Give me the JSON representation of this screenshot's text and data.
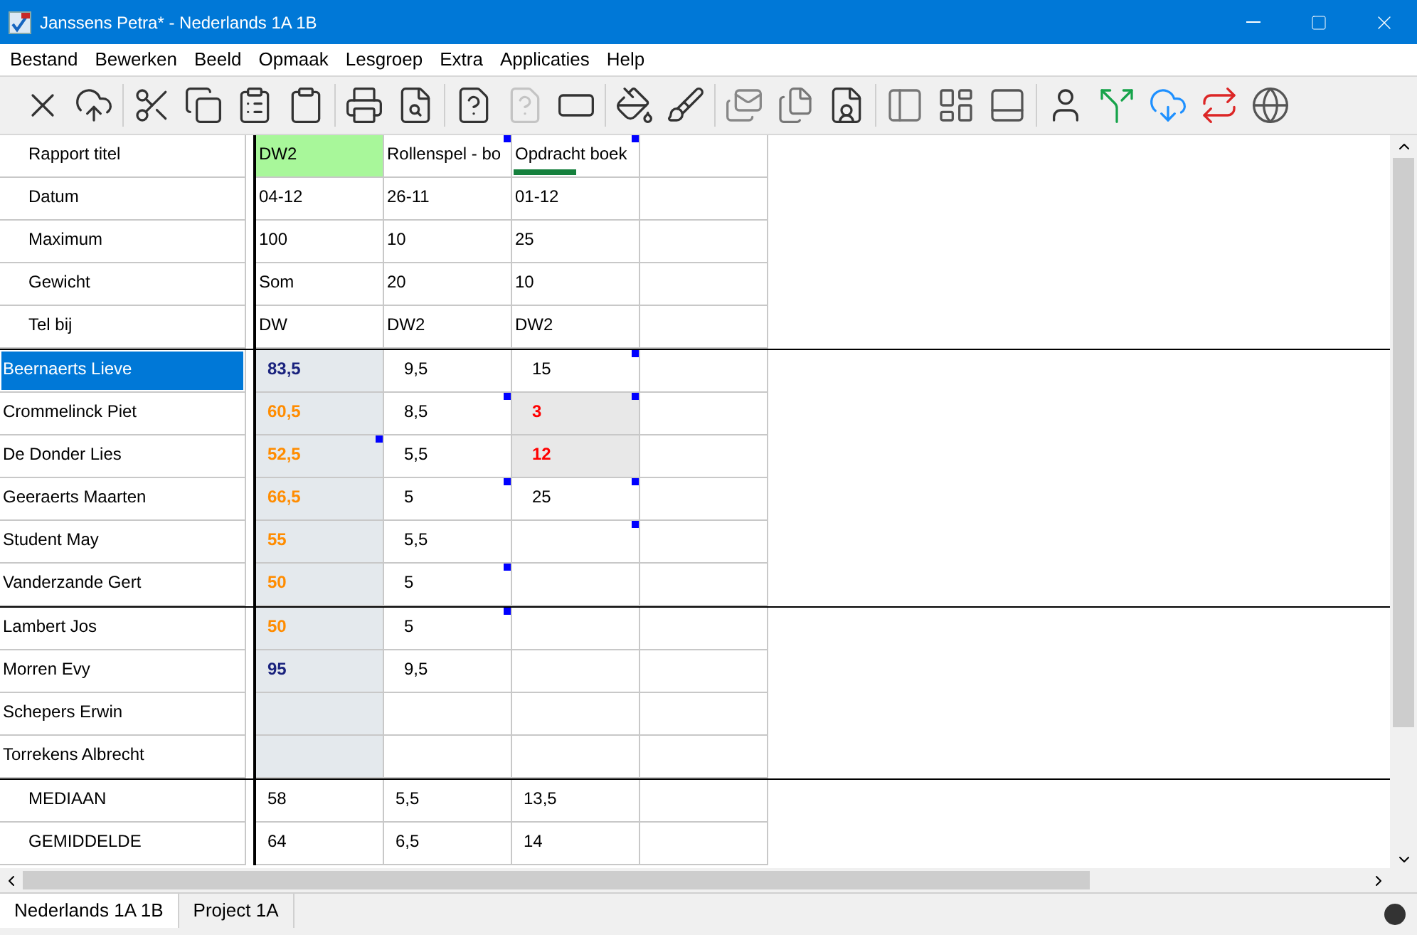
{
  "window": {
    "title": "Janssens Petra* - Nederlands 1A 1B"
  },
  "menu": [
    "Bestand",
    "Bewerken",
    "Beeld",
    "Opmaak",
    "Lesgroep",
    "Extra",
    "Applicaties",
    "Help"
  ],
  "toolbar": [
    {
      "disabled": false
    },
    {
      "disabled": false
    },
    {
      "disabled": false
    },
    {
      "disabled": false
    },
    {
      "disabled": false
    },
    {
      "disabled": false
    },
    {
      "disabled": false
    },
    {
      "disabled": false
    },
    {
      "disabled": false
    },
    {
      "disabled": true
    },
    {
      "disabled": false
    },
    {
      "disabled": false
    },
    {
      "disabled": false
    },
    {
      "disabled": false
    },
    {
      "disabled": false
    },
    {
      "disabled": false
    },
    {
      "disabled": false
    },
    {
      "disabled": false
    },
    {
      "disabled": false
    },
    {
      "disabled": false
    },
    {
      "disabled": false
    },
    {
      "disabled": false
    },
    {
      "disabled": false
    },
    {
      "disabled": false
    }
  ],
  "header_rows": [
    {
      "label": "Rapport titel",
      "cells": [
        {
          "text": "DW2",
          "highlight": true,
          "marker": false,
          "bar": false
        },
        {
          "text": "Rollenspel - bo",
          "highlight": false,
          "marker": true,
          "bar": false
        },
        {
          "text": "Opdracht boek",
          "highlight": false,
          "marker": true,
          "bar": true
        }
      ]
    },
    {
      "label": "Datum",
      "cells": [
        {
          "text": "04-12"
        },
        {
          "text": "26-11"
        },
        {
          "text": "01-12"
        }
      ]
    },
    {
      "label": "Maximum",
      "cells": [
        {
          "text": "100"
        },
        {
          "text": "10"
        },
        {
          "text": "25"
        }
      ]
    },
    {
      "label": "Gewicht",
      "cells": [
        {
          "text": "Som"
        },
        {
          "text": "20"
        },
        {
          "text": "10"
        }
      ]
    },
    {
      "label": "Tel bij",
      "cells": [
        {
          "text": "DW"
        },
        {
          "text": "DW2"
        },
        {
          "text": "DW2"
        }
      ]
    }
  ],
  "student_groups": [
    [
      {
        "name": "Beernaerts Lieve",
        "selected": true,
        "cells": [
          {
            "text": "83,5",
            "color": "#1a237e",
            "shaded": true,
            "marker": false
          },
          {
            "text": "9,5",
            "shaded": false,
            "marker": false
          },
          {
            "text": "15",
            "shaded": false,
            "marker": true
          }
        ]
      },
      {
        "name": "Crommelinck Piet",
        "selected": false,
        "cells": [
          {
            "text": "60,5",
            "color": "#ff8c00",
            "shaded": true,
            "marker": false
          },
          {
            "text": "8,5",
            "shaded": false,
            "marker": true
          },
          {
            "text": "3",
            "color": "#ff0000",
            "shaded": true,
            "marker": true
          }
        ]
      },
      {
        "name": "De Donder Lies",
        "selected": false,
        "cells": [
          {
            "text": "52,5",
            "color": "#ff8c00",
            "shaded": true,
            "marker": true
          },
          {
            "text": "5,5",
            "shaded": false,
            "marker": false
          },
          {
            "text": "12",
            "color": "#ff0000",
            "shaded": true,
            "marker": false
          }
        ]
      },
      {
        "name": "Geeraerts Maarten",
        "selected": false,
        "cells": [
          {
            "text": "66,5",
            "color": "#ff8c00",
            "shaded": true,
            "marker": false
          },
          {
            "text": "5",
            "shaded": false,
            "marker": true
          },
          {
            "text": "25",
            "shaded": false,
            "marker": true
          }
        ]
      },
      {
        "name": "Student May",
        "selected": false,
        "cells": [
          {
            "text": "55",
            "color": "#ff8c00",
            "shaded": true,
            "marker": false
          },
          {
            "text": "5,5",
            "shaded": false,
            "marker": false
          },
          {
            "text": "",
            "shaded": false,
            "marker": true
          }
        ]
      },
      {
        "name": "Vanderzande Gert",
        "selected": false,
        "cells": [
          {
            "text": "50",
            "color": "#ff8c00",
            "shaded": true,
            "marker": false
          },
          {
            "text": "5",
            "shaded": false,
            "marker": true
          },
          {
            "text": "",
            "shaded": false,
            "marker": false
          }
        ]
      }
    ],
    [
      {
        "name": "Lambert Jos",
        "selected": false,
        "cells": [
          {
            "text": "50",
            "color": "#ff8c00",
            "shaded": true,
            "marker": false
          },
          {
            "text": "5",
            "shaded": false,
            "marker": true
          },
          {
            "text": "",
            "shaded": false,
            "marker": false
          }
        ]
      },
      {
        "name": "Morren Evy",
        "selected": false,
        "cells": [
          {
            "text": "95",
            "color": "#1a237e",
            "shaded": true,
            "marker": false
          },
          {
            "text": "9,5",
            "shaded": false,
            "marker": false
          },
          {
            "text": "",
            "shaded": false,
            "marker": false
          }
        ]
      },
      {
        "name": "Schepers Erwin",
        "selected": false,
        "cells": [
          {
            "text": "",
            "shaded": true,
            "marker": false
          },
          {
            "text": "",
            "shaded": false,
            "marker": false
          },
          {
            "text": "",
            "shaded": false,
            "marker": false
          }
        ]
      },
      {
        "name": "Torrekens Albrecht",
        "selected": false,
        "cells": [
          {
            "text": "",
            "shaded": true,
            "marker": false
          },
          {
            "text": "",
            "shaded": false,
            "marker": false
          },
          {
            "text": "",
            "shaded": false,
            "marker": false
          }
        ]
      }
    ]
  ],
  "stat_rows": [
    {
      "label": "MEDIAAN",
      "cells": [
        "58",
        "5,5",
        "13,5"
      ]
    },
    {
      "label": "GEMIDDELDE",
      "cells": [
        "64",
        "6,5",
        "14"
      ]
    }
  ],
  "sheet_tabs": [
    {
      "label": "Nederlands 1A 1B",
      "selected": true
    },
    {
      "label": "Project 1A",
      "selected": false
    }
  ]
}
